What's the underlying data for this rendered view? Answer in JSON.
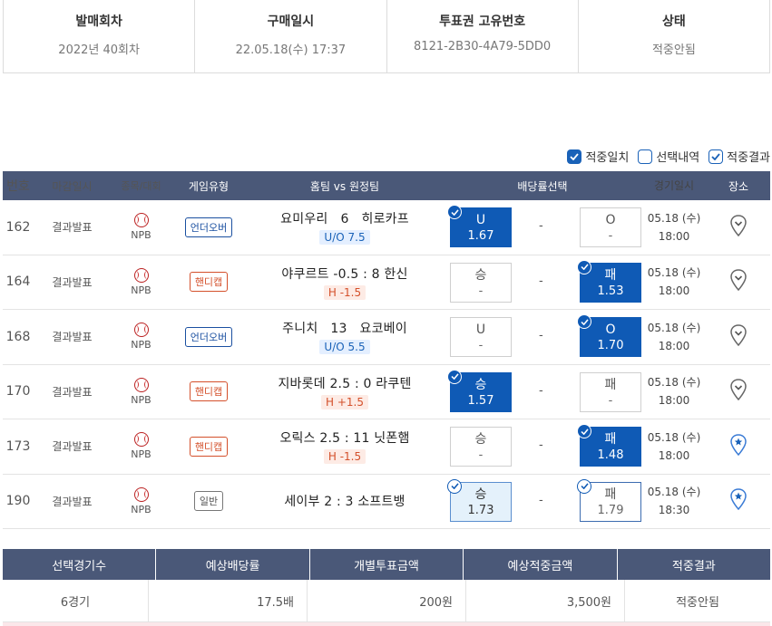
{
  "info": [
    {
      "label": "발매회차",
      "value": "2022년 40회차"
    },
    {
      "label": "구매일시",
      "value": "22.05.18(수) 17:37"
    },
    {
      "label": "투표권 고유번호",
      "value": "8121-2B30-4A79-5DD0"
    },
    {
      "label": "상태",
      "value": "적중안됨"
    }
  ],
  "legend": {
    "hit": "적중일치",
    "selection": "선택내역",
    "result": "적중결과"
  },
  "table": {
    "headers": [
      "번호",
      "마감일시",
      "종목/대회",
      "게임유형",
      "홈팀 vs 원정팀",
      "배당률선택",
      "경기일시",
      "장소"
    ],
    "rows": [
      {
        "no": "162",
        "deadline": "결과발표",
        "league": "NPB",
        "type": "언더오버",
        "type_kind": "uo",
        "match": "요미우리   6   히로카프",
        "sub": "U/O 7.5",
        "o1": "U",
        "v1": "1.67",
        "s1": "sel",
        "mid": "-",
        "o3": "O",
        "v3": "-",
        "s3": "",
        "date": "05.18 (수)",
        "time": "18:00",
        "star": false
      },
      {
        "no": "164",
        "deadline": "결과발표",
        "league": "NPB",
        "type": "핸디캡",
        "type_kind": "hc",
        "match": "야쿠르트 -0.5 : 8 한신",
        "sub": "H -1.5",
        "o1": "승",
        "v1": "-",
        "s1": "",
        "mid": "-",
        "o3": "패",
        "v3": "1.53",
        "s3": "sel",
        "date": "05.18 (수)",
        "time": "18:00",
        "star": false
      },
      {
        "no": "168",
        "deadline": "결과발표",
        "league": "NPB",
        "type": "언더오버",
        "type_kind": "uo",
        "match": "주니치   13   요코베이",
        "sub": "U/O 5.5",
        "o1": "U",
        "v1": "-",
        "s1": "",
        "mid": "-",
        "o3": "O",
        "v3": "1.70",
        "s3": "sel",
        "date": "05.18 (수)",
        "time": "18:00",
        "star": false
      },
      {
        "no": "170",
        "deadline": "결과발표",
        "league": "NPB",
        "type": "핸디캡",
        "type_kind": "hc",
        "match": "지바롯데 2.5 : 0 라쿠텐",
        "sub": "H +1.5",
        "o1": "승",
        "v1": "1.57",
        "s1": "sel",
        "mid": "-",
        "o3": "패",
        "v3": "-",
        "s3": "",
        "date": "05.18 (수)",
        "time": "18:00",
        "star": false
      },
      {
        "no": "173",
        "deadline": "결과발표",
        "league": "NPB",
        "type": "핸디캡",
        "type_kind": "hc",
        "match": "오릭스 2.5 : 11 닛폰햄",
        "sub": "H -1.5",
        "o1": "승",
        "v1": "-",
        "s1": "",
        "mid": "-",
        "o3": "패",
        "v3": "1.48",
        "s3": "sel",
        "date": "05.18 (수)",
        "time": "18:00",
        "star": true
      },
      {
        "no": "190",
        "deadline": "결과발표",
        "league": "NPB",
        "type": "일반",
        "type_kind": "gen",
        "match": "세이부 2 : 3 소프트뱅",
        "sub": "",
        "o1": "승",
        "v1": "1.73",
        "s1": "light",
        "mid": "-",
        "o3": "패",
        "v3": "1.79",
        "s3": "ring",
        "date": "05.18 (수)",
        "time": "18:30",
        "star": true
      }
    ]
  },
  "summary": {
    "headers": [
      "선택경기수",
      "예상배당률",
      "개별투표금액",
      "예상적중금액",
      "적중결과"
    ],
    "values": [
      "6경기",
      "17.5배",
      "200원",
      "3,500원",
      "적중안됨"
    ]
  },
  "colors": {
    "header_bg": "#4a5878",
    "selected": "#0f5ab5",
    "handicap": "#d4502b",
    "underover": "#1a62b8"
  }
}
